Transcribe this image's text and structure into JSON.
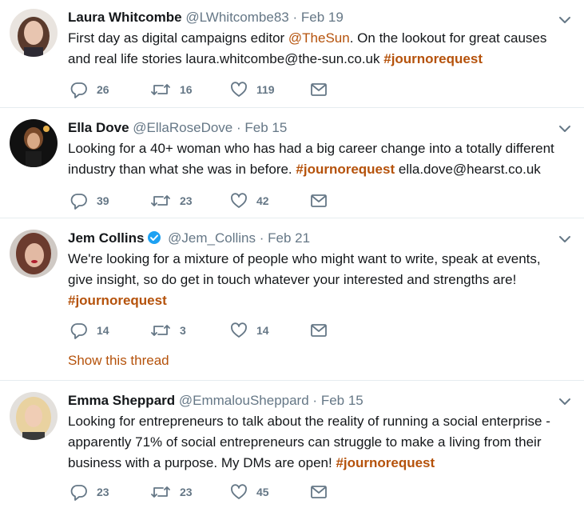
{
  "tweets": [
    {
      "name": "Laura Whitcombe",
      "handle": "@LWhitcombe83",
      "sep": "·",
      "date": "Feb 19",
      "text_a": "First day as digital campaigns editor ",
      "mention": "@TheSun",
      "text_b": ". On the lookout for great causes\nand real life stories laura.whitcombe@the-sun.co.uk ",
      "hashtag": "#journorequest",
      "text_c": "",
      "replies": "26",
      "retweets": "16",
      "likes": "119"
    },
    {
      "name": "Ella Dove",
      "handle": "@EllaRoseDove",
      "sep": "·",
      "date": "Feb 15",
      "text_a": "Looking for a 40+ woman who has had a big career change into a totally different\nindustry than what she was in before. ",
      "hashtag": "#journorequest",
      "text_c": " ella.dove@hearst.co.uk",
      "replies": "39",
      "retweets": "23",
      "likes": "42"
    },
    {
      "name": "Jem Collins",
      "handle": "@Jem_Collins",
      "sep": "·",
      "date": "Feb 21",
      "verified": true,
      "text_a": "We're looking for a mixture of people who might want to write, speak at events,\ngive insight, so do get in touch whatever your interested and strengths are!\n",
      "hashtag": "#journorequest",
      "text_c": "",
      "replies": "14",
      "retweets": "3",
      "likes": "14",
      "thread_link": "Show this thread"
    },
    {
      "name": "Emma Sheppard",
      "handle": "@EmmalouSheppard",
      "sep": "·",
      "date": "Feb 15",
      "text_a": "Looking for entrepreneurs to talk about the reality of running a social enterprise -\napparently 71% of social entrepreneurs can struggle to make a living from their\nbusiness with a purpose. My DMs are open! ",
      "hashtag": "#journorequest",
      "text_c": "",
      "replies": "23",
      "retweets": "23",
      "likes": "45"
    }
  ],
  "colors": {
    "accent": "#b5520b",
    "muted": "#657786",
    "verified": "#1da1f2"
  },
  "icons": {
    "reply": "reply-icon",
    "retweet": "retweet-icon",
    "like": "heart-icon",
    "dm": "envelope-icon",
    "more": "chevron-down-icon"
  }
}
